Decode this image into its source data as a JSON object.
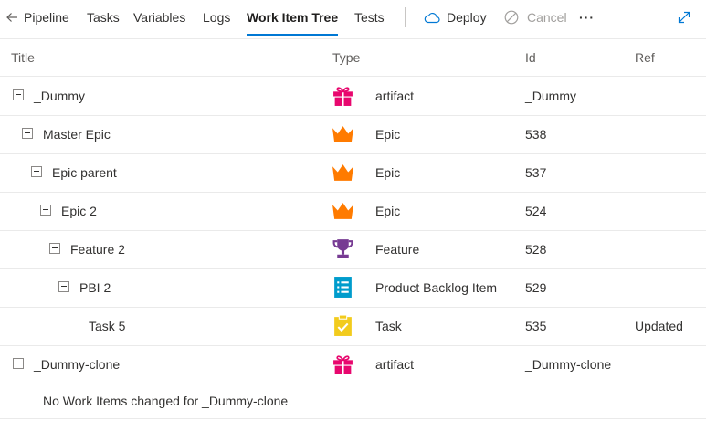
{
  "toolbar": {
    "back_label": "Pipeline",
    "tabs": [
      {
        "label": "Tasks"
      },
      {
        "label": "Variables"
      },
      {
        "label": "Logs"
      },
      {
        "label": "Work Item Tree"
      },
      {
        "label": "Tests"
      }
    ],
    "active_tab": "Work Item Tree",
    "deploy_label": "Deploy",
    "cancel_label": "Cancel",
    "more_label": "···"
  },
  "table": {
    "headers": {
      "title": "Title",
      "type": "Type",
      "id": "Id",
      "ref": "Ref"
    },
    "rows": [
      {
        "title": "_Dummy",
        "type": "artifact",
        "id": "_Dummy",
        "ref": "",
        "icon": "gift-icon"
      },
      {
        "title": "Master Epic",
        "type": "Epic",
        "id": "538",
        "ref": "",
        "icon": "crown-icon"
      },
      {
        "title": "Epic parent",
        "type": "Epic",
        "id": "537",
        "ref": "",
        "icon": "crown-icon"
      },
      {
        "title": "Epic 2",
        "type": "Epic",
        "id": "524",
        "ref": "",
        "icon": "crown-icon"
      },
      {
        "title": "Feature 2",
        "type": "Feature",
        "id": "528",
        "ref": "",
        "icon": "trophy-icon"
      },
      {
        "title": "PBI 2",
        "type": "Product Backlog Item",
        "id": "529",
        "ref": "",
        "icon": "backlog-item-icon"
      },
      {
        "title": "Task 5",
        "type": "Task",
        "id": "535",
        "ref": "Updated",
        "icon": "task-clipboard-icon"
      },
      {
        "title": "_Dummy-clone",
        "type": "artifact",
        "id": "_Dummy-clone",
        "ref": "",
        "icon": "gift-icon"
      }
    ],
    "empty_message": "No Work Items changed for _Dummy-clone"
  },
  "colors": {
    "accent": "#0078d4",
    "artifact": "#e8076e",
    "epic": "#ff7b00",
    "feature": "#773b93",
    "backlog_item": "#009ccc",
    "task": "#f2cb1d"
  }
}
